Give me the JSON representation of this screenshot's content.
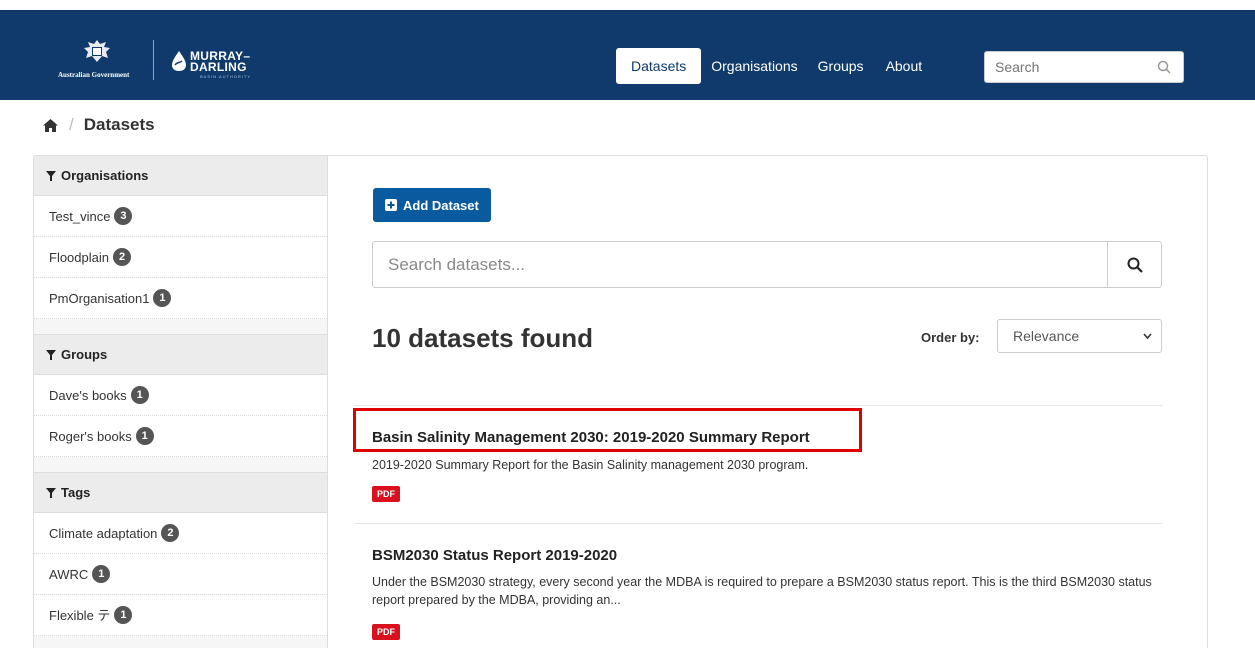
{
  "header": {
    "gov_logo_text": "Australian Government",
    "mdba_name_line1": "MURRAY–",
    "mdba_name_line2": "DARLING",
    "mdba_name_line3": "BASIN AUTHORITY",
    "nav": [
      "Datasets",
      "Organisations",
      "Groups",
      "About"
    ],
    "search_placeholder": "Search",
    "brand_color": "#0f3a6b"
  },
  "breadcrumb": {
    "current": "Datasets"
  },
  "sidebar": {
    "organisations": {
      "title": "Organisations",
      "items": [
        {
          "label": "Test_vince",
          "count": "3"
        },
        {
          "label": "Floodplain",
          "count": "2"
        },
        {
          "label": "PmOrganisation1",
          "count": "1"
        }
      ]
    },
    "groups": {
      "title": "Groups",
      "items": [
        {
          "label": "Dave's books",
          "count": "1"
        },
        {
          "label": "Roger's books",
          "count": "1"
        }
      ]
    },
    "tags": {
      "title": "Tags",
      "items": [
        {
          "label": "Climate adaptation",
          "count": "2"
        },
        {
          "label": "AWRC",
          "count": "1"
        },
        {
          "label": "Flexible テ",
          "count": "1"
        }
      ]
    }
  },
  "main": {
    "add_label": "Add Dataset",
    "search_placeholder": "Search datasets...",
    "count_text": "10 datasets found",
    "order_label": "Order by:",
    "order_value": "Relevance",
    "datasets": [
      {
        "title": "Basin Salinity Management 2030: 2019-2020 Summary Report",
        "desc": "2019-2020 Summary Report for the Basin Salinity management 2030 program.",
        "format": "PDF"
      },
      {
        "title": "BSM2030 Status Report 2019-2020",
        "desc": "Under the BSM2030 strategy, every second year the MDBA is required to prepare a BSM2030 status report. This is the third BSM2030 status report prepared by the MDBA, providing an...",
        "format": "PDF"
      }
    ]
  }
}
